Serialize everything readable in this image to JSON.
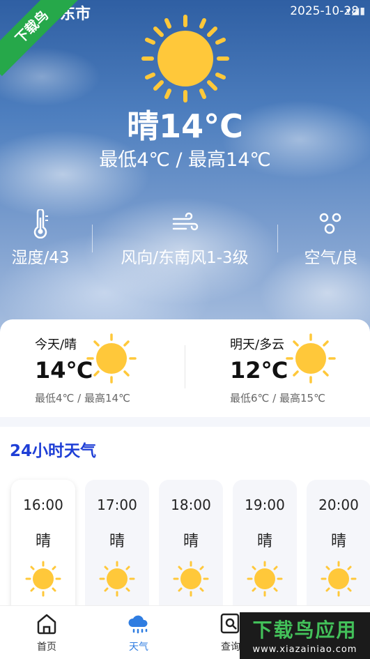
{
  "status": {
    "time": "2025-10-28",
    "icons": "▾◢▮"
  },
  "header": {
    "city": "东市",
    "watermark": "下载鸟"
  },
  "current": {
    "condition_temp": "晴14°C",
    "range": "最低4℃  /  最高14℃"
  },
  "metrics": [
    {
      "label": "湿度/43",
      "icon": "thermometer-icon"
    },
    {
      "label": "风向/东南风1-3级",
      "icon": "wind-icon"
    },
    {
      "label": "空气/良",
      "icon": "air-bubbles-icon"
    }
  ],
  "days": [
    {
      "label": "今天/晴",
      "temp": "14℃",
      "range": "最低4℃ / 最高14℃"
    },
    {
      "label": "明天/多云",
      "temp": "12℃",
      "range": "最低6℃ / 最高15℃"
    }
  ],
  "hourly": {
    "title": "24小时天气",
    "items": [
      {
        "time": "16:00",
        "cond": "晴"
      },
      {
        "time": "17:00",
        "cond": "晴"
      },
      {
        "time": "18:00",
        "cond": "晴"
      },
      {
        "time": "19:00",
        "cond": "晴"
      },
      {
        "time": "20:00",
        "cond": "晴"
      }
    ]
  },
  "nav": [
    {
      "label": "首页",
      "icon": "home-icon"
    },
    {
      "label": "天气",
      "icon": "cloud-rain-icon"
    },
    {
      "label": "查询",
      "icon": "search-doc-icon"
    }
  ],
  "brand": {
    "name": "下载鸟应用",
    "url": "www.xiazainiao.com"
  },
  "colors": {
    "sun": "#FFC83A",
    "accent": "#1F3FD6",
    "nav_active": "#2F7DE1",
    "brand_green": "#43C15A"
  }
}
